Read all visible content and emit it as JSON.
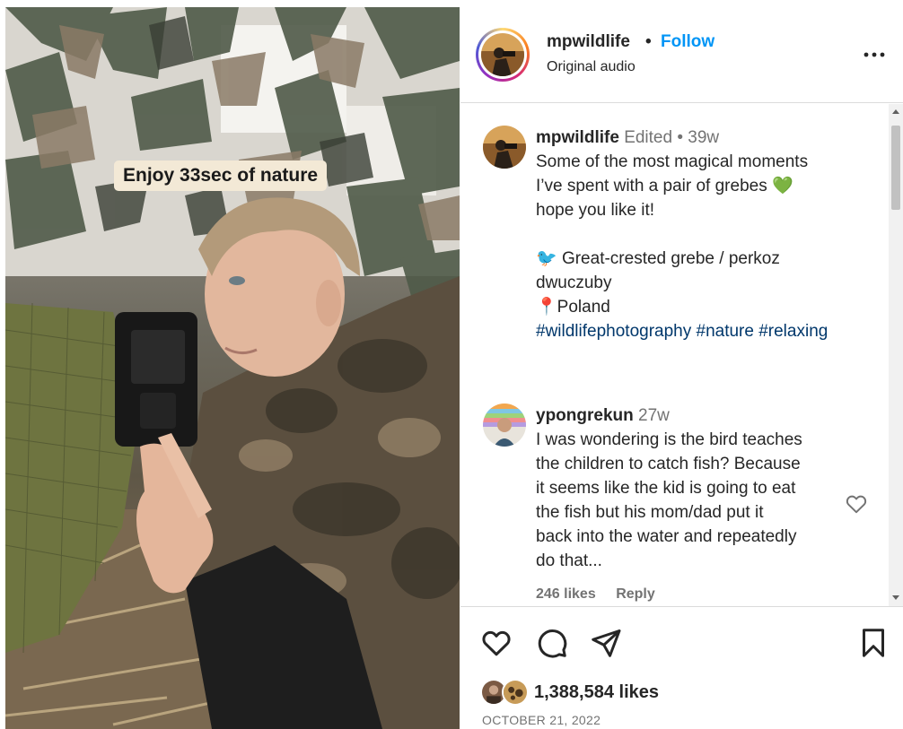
{
  "media": {
    "overlay_text": "Enjoy 33sec of nature"
  },
  "header": {
    "username": "mpwildlife",
    "separator": "•",
    "follow_label": "Follow",
    "audio_label": "Original audio",
    "more_icon": "more-horizontal-icon"
  },
  "caption": {
    "username": "mpwildlife",
    "edited": "Edited",
    "separator": "•",
    "age": "39w",
    "line1": "Some of the most magical moments",
    "line2": "I’ve spent with a pair of grebes",
    "heart_emoji": "💚",
    "line3": "hope you like it!",
    "bird_emoji": "🐦",
    "species_line1": "Great-crested grebe / perkoz",
    "species_line2": "dwuczuby",
    "pin_emoji": "📍",
    "location": "Poland",
    "hashtags": "#wildlifephotography #nature #relaxing"
  },
  "comment": {
    "username": "ypongrekun",
    "age": "27w",
    "lines": [
      "I was wondering is the bird teaches",
      "the children to catch fish? Because",
      "it seems like the kid is going to eat",
      "the fish but his mom/dad put it",
      "back into the water and repeatedly",
      "do that..."
    ],
    "likes": "246 likes",
    "reply_label": "Reply"
  },
  "actions": {
    "icons": [
      "heart-icon",
      "comment-icon",
      "share-icon",
      "bookmark-icon"
    ],
    "likes_count": "1,388,584 likes",
    "date": "OCTOBER 21, 2022"
  },
  "colors": {
    "accent": "#0095f6",
    "hashtag": "#00376b",
    "muted": "#737373",
    "divider": "#dbdbdb",
    "overlay_chip": "#f3e9d6"
  }
}
